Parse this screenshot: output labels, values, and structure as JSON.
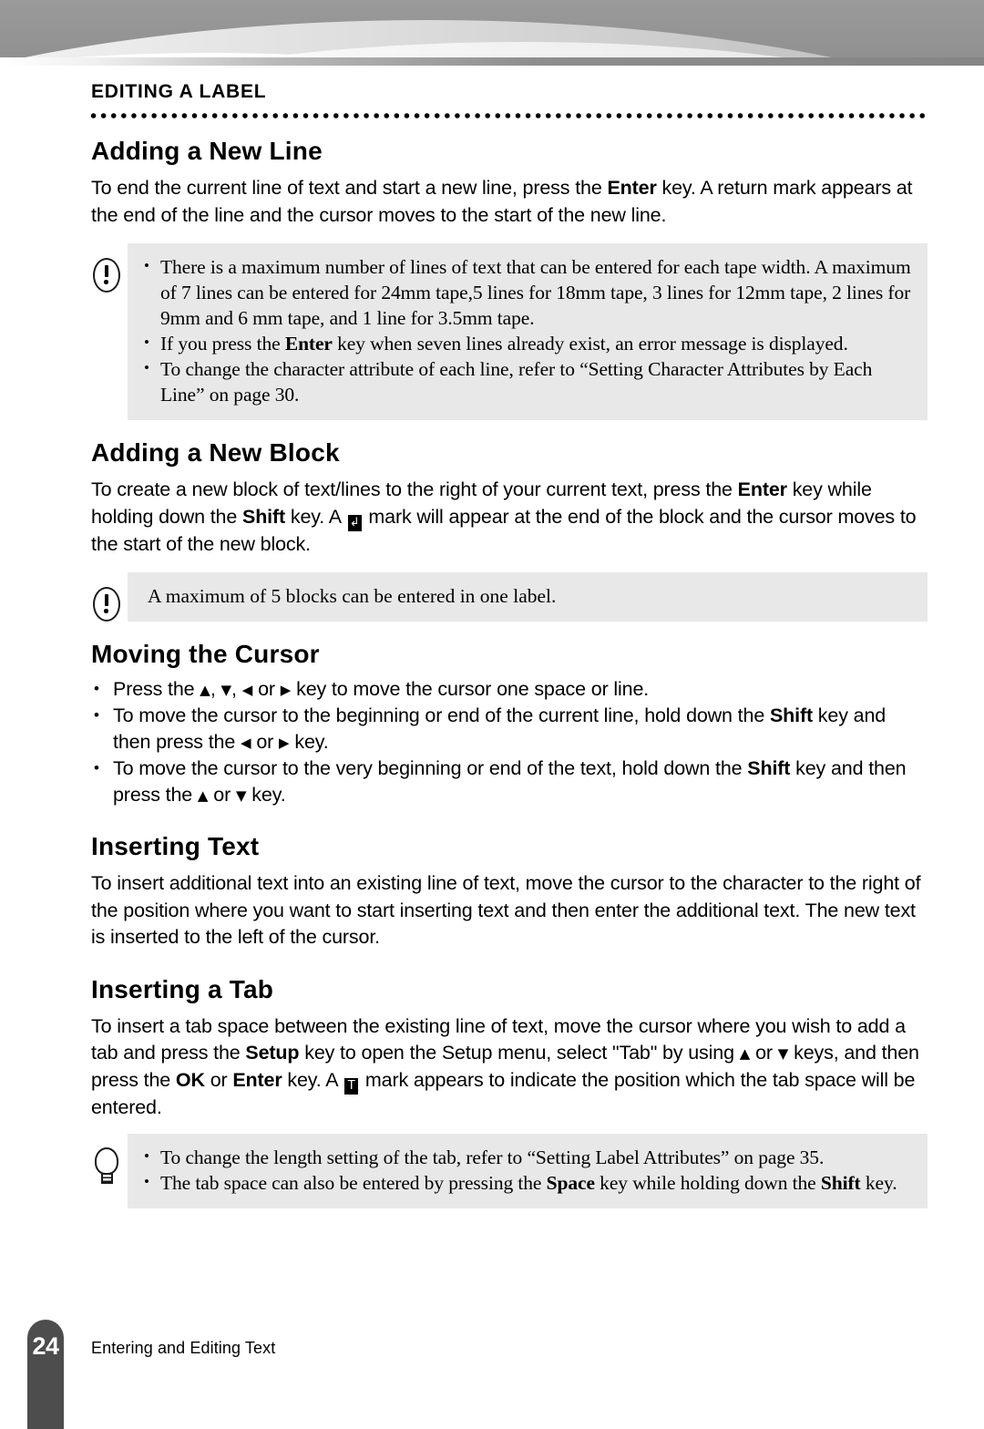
{
  "chapter": {
    "label": "EDITING A LABEL"
  },
  "sections": {
    "adding_new_line": {
      "title": "Adding a New Line",
      "para_1": "To end the current line of text and start a new line, press the ",
      "para_1_key": "Enter",
      "para_1_cont": " key. A return mark appears at the end of the line and the cursor moves to the start of the new line.",
      "note": {
        "bullet_1_a": "There is a maximum number of lines of text that can be entered for each tape width. A maximum of 7 lines can be entered for 24mm tape,5 lines for 18mm tape, 3 lines for 12mm tape, 2 lines for 9mm and 6 mm tape, and 1 line for 3.5mm tape.",
        "bullet_2_a": "If you press the ",
        "bullet_2_key": "Enter",
        "bullet_2_b": " key when seven lines already exist, an error message is displayed.",
        "bullet_3_a": "To change the character attribute of each line, refer to “Setting Character Attributes by Each Line” on page 30."
      }
    },
    "adding_new_block": {
      "title": "Adding a New Block",
      "para_a": "To create a new block of text/lines to the right of your current text, press the ",
      "para_key_1": "Enter",
      "para_b": " key while holding down the ",
      "para_key_2": "Shift",
      "para_c": " key. A ",
      "para_d": " mark will appear at the end of the block and the cursor moves to the start of the new block.",
      "note": {
        "text": "A maximum of 5 blocks can be entered in one label."
      }
    },
    "moving_cursor": {
      "title": "Moving the Cursor",
      "bullet_1_a": "Press the ",
      "bullet_1_b": ", ",
      "bullet_1_c": ", ",
      "bullet_1_d": " or ",
      "bullet_1_e": " key to move the cursor one space or line.",
      "bullet_2_a": "To move the cursor to the beginning or end of the current line, hold down the ",
      "bullet_2_key": "Shift",
      "bullet_2_b": " key and then press the ",
      "bullet_2_c": " or ",
      "bullet_2_d": " key.",
      "bullet_3_a": "To move the cursor to the very beginning or end of the text, hold down the ",
      "bullet_3_key": "Shift",
      "bullet_3_b": " key and then press the ",
      "bullet_3_c": " or ",
      "bullet_3_d": " key."
    },
    "inserting_text": {
      "title": "Inserting Text",
      "para": "To insert additional text into an existing line of text, move the cursor to the character to the right of the position where you want to start inserting text and then enter the additional text. The new text is inserted to the left of the cursor."
    },
    "inserting_tab": {
      "title": "Inserting a Tab",
      "para_a": "To insert a tab space between the existing line of text, move the cursor where you wish to add a tab and press the ",
      "para_key_setup": "Setup",
      "para_b": " key to open the Setup menu, select \"Tab\" by using ",
      "para_c": " or ",
      "para_d": " keys, and then press the ",
      "para_key_ok": "OK",
      "para_e": " or ",
      "para_key_enter": "Enter",
      "para_f": " key. A ",
      "para_g": " mark appears to indicate the position which the tab space will be entered.",
      "tip": {
        "bullet_1": "To change the length setting of the tab, refer to “Setting Label Attributes” on page 35.",
        "bullet_2_a": "The tab space can also be entered by pressing the ",
        "bullet_2_key_1": "Space",
        "bullet_2_b": " key while holding down the ",
        "bullet_2_key_2": "Shift",
        "bullet_2_c": " key."
      }
    }
  },
  "glyphs": {
    "return_mark": "↲",
    "tab_mark": "T",
    "arrow_up": "▲",
    "arrow_down": "▼",
    "arrow_left": "◀",
    "arrow_right": "▶"
  },
  "footer": {
    "page_number": "24",
    "title": "Entering and Editing Text"
  },
  "colors": {
    "callout_background": "#e8e8e8",
    "page_tab": "#4d4d4d",
    "text": "#000000"
  }
}
